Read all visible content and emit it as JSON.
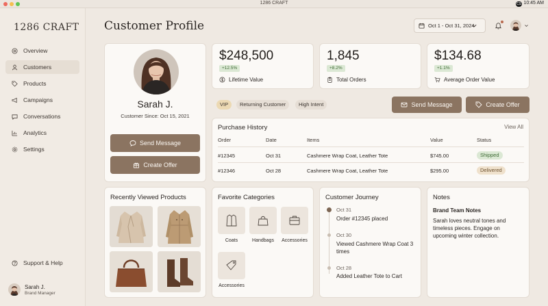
{
  "window": {
    "title": "1286 CRAFT",
    "time": "10:45 AM",
    "status_icon": "CS"
  },
  "sidebar": {
    "brand": "1286 CRAFT",
    "items": [
      {
        "label": "Overview",
        "icon": "target-icon"
      },
      {
        "label": "Customers",
        "icon": "user-icon",
        "active": true
      },
      {
        "label": "Products",
        "icon": "tag-icon"
      },
      {
        "label": "Campaigns",
        "icon": "megaphone-icon"
      },
      {
        "label": "Conversations",
        "icon": "chat-icon"
      },
      {
        "label": "Analytics",
        "icon": "chart-icon"
      },
      {
        "label": "Settings",
        "icon": "gear-icon"
      }
    ],
    "support": "Support & Help",
    "user": {
      "name": "Sarah J.",
      "role": "Brand Manager"
    }
  },
  "header": {
    "title": "Customer Profile",
    "date_range": "Oct 1 - Oct 31, 2024"
  },
  "profile": {
    "name": "Sarah J.",
    "since": "Customer Since: Oct 15, 2021",
    "send_message": "Send Message",
    "create_offer": "Create Offer"
  },
  "stats": [
    {
      "value": "$248,500",
      "change": "+12.5%",
      "label": "Lifetime Value"
    },
    {
      "value": "1,845",
      "change": "+8.2%",
      "label": "Total Orders"
    },
    {
      "value": "$134.68",
      "change": "+1.1%",
      "label": "Average Order Value"
    }
  ],
  "tags": [
    "VIP",
    "Returning Customer",
    "High Intent"
  ],
  "actions": {
    "send_message": "Send Message",
    "create_offer": "Create Offer"
  },
  "purchase_history": {
    "title": "Purchase History",
    "view_all": "View All",
    "columns": [
      "Order",
      "Date",
      "Items",
      "Value",
      "Status"
    ],
    "rows": [
      {
        "order": "#12345",
        "date": "Oct 31",
        "items": "Cashmere Wrap Coat, Leather Tote",
        "value": "$745.00",
        "status": "Shipped"
      },
      {
        "order": "#12346",
        "date": "Oct 28",
        "items": "Cashmere Wrap Coat, Leather Tote",
        "value": "$295.00",
        "status": "Delivered"
      }
    ]
  },
  "recently_viewed": {
    "title": "Recently Viewed Products"
  },
  "favorite_categories": {
    "title": "Favorite Categories",
    "items": [
      "Coats",
      "Handbags",
      "Accessories",
      "Accessories"
    ]
  },
  "journey": {
    "title": "Customer Journey",
    "events": [
      {
        "date": "Oct 31",
        "text": "Order #12345 placed"
      },
      {
        "date": "Oct 30",
        "text": "Viewed Cashmere Wrap Coat 3 times"
      },
      {
        "date": "Oct 28",
        "text": "Added Leather Tote to Cart"
      }
    ]
  },
  "notes": {
    "title": "Notes",
    "subtitle": "Brand Team Notes",
    "body": "Sarah loves neutral tones and timeless pieces. Engage on upcoming winter collection."
  },
  "colors": {
    "accent": "#8b7461",
    "background": "#efe9e2",
    "card": "#fbf9f6",
    "shipped": "#dbe8d4",
    "delivered": "#efe1cc"
  }
}
